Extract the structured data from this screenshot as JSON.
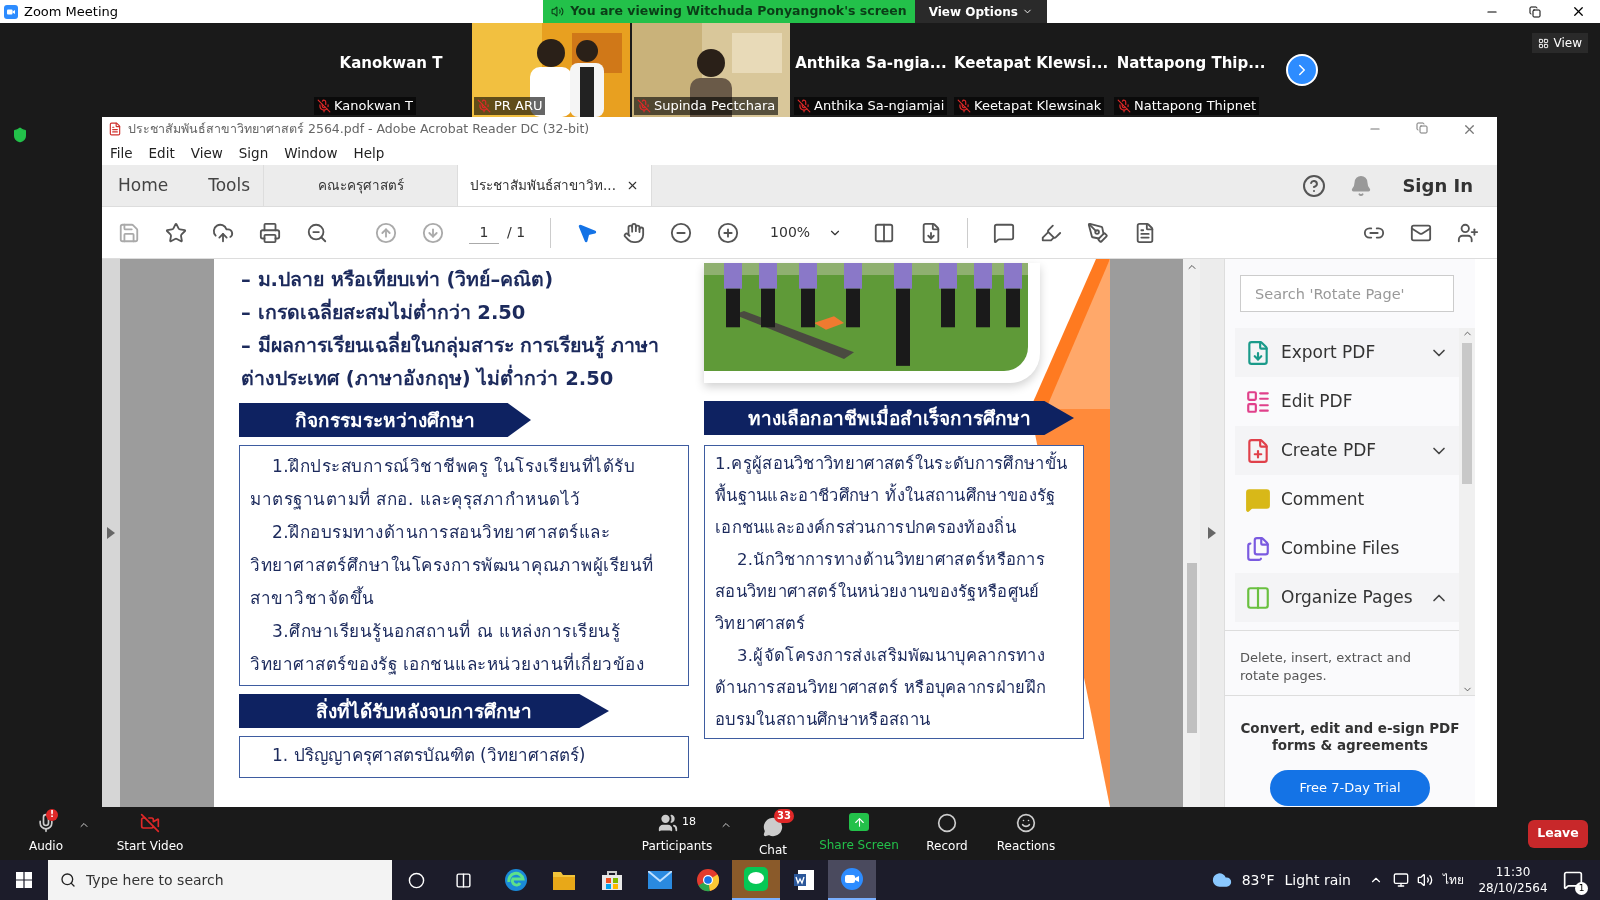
{
  "zoom_window": {
    "title": "Zoom Meeting"
  },
  "share_banner": {
    "text": "You are viewing Witchuda Ponyangnok's screen",
    "view_options": "View Options"
  },
  "gallery": {
    "view_button": "View",
    "tiles": [
      {
        "kind": "name",
        "display": "Kanokwan T",
        "name": "Kanokwan T",
        "muted": true
      },
      {
        "kind": "video",
        "name": "PR ARU",
        "muted": true
      },
      {
        "kind": "video",
        "name": "Supinda Pectchara",
        "muted": true
      },
      {
        "kind": "name",
        "display": "Anthika Sa-ngia...",
        "name": "Anthika Sa-ngiamjai",
        "muted": true
      },
      {
        "kind": "name",
        "display": "Keetapat Klewsi...",
        "name": "Keetapat Klewsinak",
        "muted": true
      },
      {
        "kind": "name",
        "display": "Nattapong Thip...",
        "name": "Nattapong Thipnet",
        "muted": true
      }
    ]
  },
  "acrobat": {
    "title": "ประชาสัมพันธ์สาขาวิทยาศาสตร์ 2564.pdf - Adobe Acrobat Reader DC (32-bit)",
    "menu": [
      "File",
      "Edit",
      "View",
      "Sign",
      "Window",
      "Help"
    ],
    "nav": [
      "Home",
      "Tools"
    ],
    "tabs": [
      {
        "label": "คณะครุศาสตร์",
        "selected": false
      },
      {
        "label": "ประชาสัมพันธ์สาขาวิท...",
        "selected": true
      }
    ],
    "sign_in": "Sign In",
    "toolbar": {
      "page": "1",
      "page_total": "/ 1",
      "zoom": "100%"
    },
    "document": {
      "requirements": [
        "– ม.ปลาย หรือเทียบเท่า (วิทย์–คณิต)",
        "– เกรดเฉลี่ยสะสมไม่ต่ำกว่า 2.50",
        "– มีผลการเรียนเฉลี่ยในกลุ่มสาระ การเรียนรู้ ภาษาต่างประเทศ (ภาษาอังกฤษ) ไม่ต่ำกว่า 2.50"
      ],
      "activities": {
        "heading": "กิจกรรมระหว่างศึกษา",
        "items": [
          "1.ฝึกประสบการณ์วิชาชีพครู ในโรงเรียนที่ได้รับมาตรฐานตามที่ สกอ. และคุรุสภากำหนดไว้",
          "2.ฝึกอบรมทางด้านการสอนวิทยาศาสตร์และวิทยาศาสตร์ศึกษาในโครงการพัฒนาคุณภาพผู้เรียนที่สาขาวิชาจัดขึ้น",
          "3.ศึกษาเรียนรู้นอกสถานที่ ณ แหล่งการเรียนรู้วิทยาศาสตร์ของรัฐ เอกชนและหน่วยงานที่เกี่ยวข้อง"
        ]
      },
      "benefits": {
        "heading": "สิ่งที่ได้รับหลังจบการศึกษา",
        "items": [
          "1. ปริญญาครุศาสตรบัณฑิต (วิทยาศาสตร์)"
        ]
      },
      "careers": {
        "heading": "ทางเลือกอาชีพเมื่อสำเร็จการศึกษา",
        "items": [
          "1.ครูผู้สอนวิชาวิทยาศาสตร์ในระดับการศึกษาขั้นพื้นฐานและอาชีวศึกษา ทั้งในสถานศึกษาของรัฐ เอกชนและองค์กรส่วนการปกครองท้องถิ่น",
          "2.นักวิชาการทางด้านวิทยาศาสตร์หรือการสอนวิทยาศาสตร์ในหน่วยงานของรัฐหรือศูนย์วิทยาศาสตร์",
          "3.ผู้จัดโครงการส่งเสริมพัฒนาบุคลากรทางด้านการสอนวิทยาศาสตร์ หรือบุคลากรฝ่ายฝึกอบรมในสถานศึกษาหรือสถาน"
        ]
      }
    },
    "tools_panel": {
      "search_placeholder": "Search 'Rotate Page'",
      "tools": [
        {
          "kind": "export",
          "label": "Export PDF",
          "expandable": true,
          "expanded": false
        },
        {
          "kind": "edit",
          "label": "Edit PDF",
          "expandable": false
        },
        {
          "kind": "create",
          "label": "Create PDF",
          "expandable": true,
          "expanded": false
        },
        {
          "kind": "comment",
          "label": "Comment",
          "expandable": false
        },
        {
          "kind": "combine",
          "label": "Combine Files",
          "expandable": false
        },
        {
          "kind": "organize",
          "label": "Organize Pages",
          "expandable": true,
          "expanded": true,
          "description": "Delete, insert, extract and rotate pages."
        }
      ],
      "promo": "Convert, edit and e-sign PDF forms & agreements",
      "trial_button": "Free 7-Day Trial"
    }
  },
  "meeting_controls": {
    "audio": {
      "label": "Audio",
      "alert": "!"
    },
    "video": {
      "label": "Start Video"
    },
    "participants": {
      "label": "Participants",
      "count": "18"
    },
    "chat": {
      "label": "Chat",
      "badge": "33"
    },
    "share": {
      "label": "Share Screen"
    },
    "record": {
      "label": "Record"
    },
    "reactions": {
      "label": "Reactions"
    },
    "leave": "Leave"
  },
  "taskbar": {
    "search_placeholder": "Type here to search",
    "apps": [
      {
        "kind": "edge",
        "active": false
      },
      {
        "kind": "folder",
        "active": false
      },
      {
        "kind": "store",
        "active": false
      },
      {
        "kind": "mail",
        "active": false
      },
      {
        "kind": "chrome",
        "active": false
      },
      {
        "kind": "line",
        "active": true
      },
      {
        "kind": "word",
        "active": false
      },
      {
        "kind": "zoom",
        "active": true
      }
    ],
    "temperature": "83°F",
    "weather": "Light rain",
    "language": "ไทย",
    "time": "11:30",
    "date": "28/10/2564",
    "notifications": "1"
  }
}
